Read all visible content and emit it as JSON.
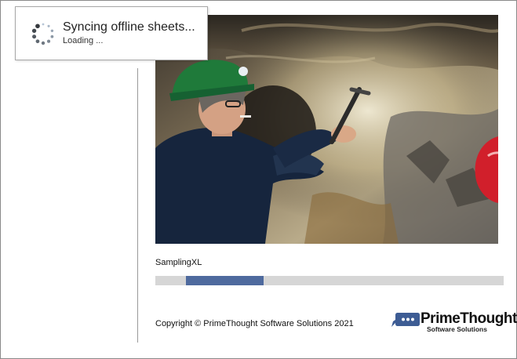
{
  "toast": {
    "title": "Syncing offline sheets...",
    "subtitle": "Loading ..."
  },
  "splash": {
    "app_name": "SamplingXL",
    "copyright": "Copyright ©  PrimeThought Software Solutions 2021",
    "progress": {
      "start": 0.088,
      "end": 0.31
    }
  },
  "logo": {
    "name": "PrimeThought",
    "tagline": "Software Solutions"
  },
  "colors": {
    "progress_fill": "#4e6a9e",
    "progress_track": "#d6d6d6",
    "logo_bubble": "#3d5c94",
    "helmet_green": "#1f7a3a",
    "helmet_red": "#d11f2b"
  },
  "icons": {
    "spinner": "loading-spinner-icon",
    "logo_mark": "speech-bubble-icon"
  }
}
